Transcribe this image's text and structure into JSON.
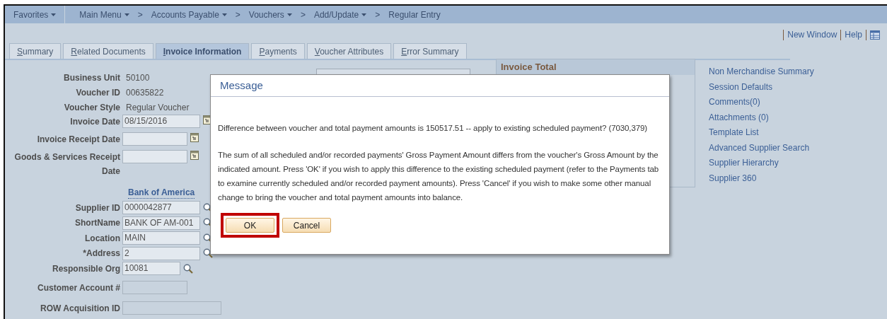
{
  "nav": [
    {
      "label": "Favorites",
      "kind": "menu"
    },
    {
      "label": "Main Menu",
      "kind": "menu"
    },
    {
      "label": "Accounts Payable",
      "kind": "crumb",
      "separator": ">"
    },
    {
      "label": "Vouchers",
      "kind": "crumb",
      "separator": ">"
    },
    {
      "label": "Add/Update",
      "kind": "crumb",
      "separator": ">"
    },
    {
      "label": "Regular Entry",
      "kind": "last",
      "separator": ">"
    }
  ],
  "header_links": [
    "New Window",
    "Help"
  ],
  "tabs": [
    {
      "label": "Summary",
      "selected": false
    },
    {
      "label": "Related Documents",
      "selected": false
    },
    {
      "label": "Invoice Information",
      "selected": true
    },
    {
      "label": "Payments",
      "selected": false
    },
    {
      "label": "Voucher Attributes",
      "selected": false
    },
    {
      "label": "Error Summary",
      "selected": false
    }
  ],
  "fields": [
    {
      "label": "Business Unit",
      "kind": "text",
      "value": "50100"
    },
    {
      "label": "Voucher ID",
      "kind": "text",
      "value": "00635822"
    },
    {
      "label": "Voucher Style",
      "kind": "text",
      "value": "Regular Voucher"
    },
    {
      "label": "Invoice Date",
      "kind": "date",
      "value": "08/15/2016"
    },
    {
      "label": "Invoice Receipt Date",
      "kind": "date"
    },
    {
      "label": "Goods & Services Receipt Date",
      "kind": "date"
    },
    {
      "kind": "link",
      "value": "Bank of America"
    },
    {
      "label": "Supplier ID",
      "kind": "lookup",
      "value": "0000042877"
    },
    {
      "label": "ShortName",
      "kind": "lookup",
      "value": "BANK OF AM-001"
    },
    {
      "label": "Location",
      "kind": "lookup",
      "value": "MAIN"
    },
    {
      "label": "*Address",
      "kind": "lookup",
      "value": "2"
    },
    {
      "label": "Responsible Org",
      "kind": "lookup",
      "value": "10081"
    },
    {
      "label": "Customer Account #",
      "kind": "input"
    },
    {
      "label": "ROW Acquisition ID",
      "kind": "input"
    }
  ],
  "invoice_total": {
    "title": "Invoice Total"
  },
  "side_links": [
    "Non Merchandise Summary",
    "Session Defaults",
    "Comments(0)",
    "Attachments (0)",
    "Template List",
    "Advanced Supplier Search",
    "Supplier Hierarchy",
    "Supplier 360"
  ],
  "dialog": {
    "title": "Message",
    "paragraphs": [
      "Difference between voucher and total payment amounts is 150517.51 -- apply to existing scheduled payment? (7030,379)",
      "The sum of all scheduled and/or recorded payments' Gross Payment Amount differs from the voucher's Gross Amount by the indicated amount.  Press 'OK' if you wish to apply this difference to the existing scheduled payment (refer to the Payments tab to examine currently scheduled and/or recorded payment amounts).  Press 'Cancel' if you wish to make some other manual change to bring the voucher and total payment amounts into balance."
    ],
    "buttons": [
      {
        "label": "OK",
        "highlighted": true
      },
      {
        "label": "Cancel",
        "highlighted": false
      }
    ]
  }
}
